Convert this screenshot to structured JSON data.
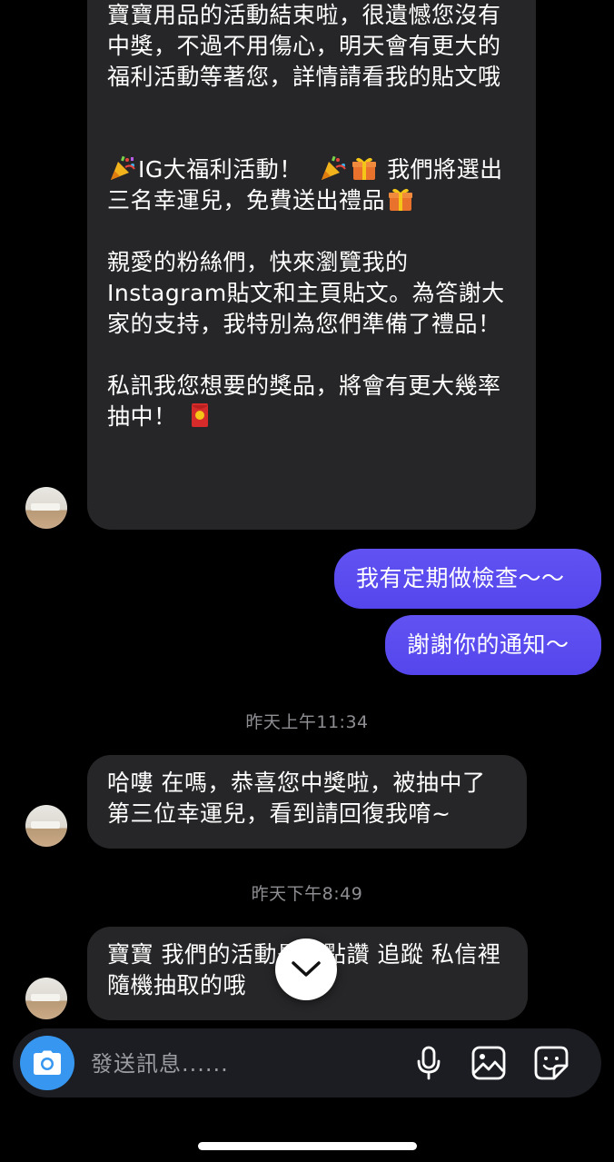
{
  "messages": {
    "first_incoming": {
      "p1": "寶寶用品的活動結束啦，很遺憾您沒有中獎，不過不用傷心，明天會有更大的福利活動等著您，詳情請看我的貼文哦",
      "p2_a": "IG大福利活動！",
      "p2_b": "我們將選出三名幸運兒，免費送出禮品",
      "p3": "親愛的粉絲們，快來瀏覽我的Instagram貼文和主頁貼文。為答謝大家的支持，我特別為您們準備了禮品！",
      "p4": "私訊我您想要的獎品，將會有更大幾率抽中！"
    },
    "outgoing_1": "我有定期做檢查～～",
    "outgoing_2": "謝謝你的通知～",
    "timestamp_1": "昨天上午11:34",
    "second_incoming": "哈嘍 在嗎，恭喜您中獎啦，被抽中了第三位幸運兒，看到請回復我唷~",
    "timestamp_2": "昨天下午8:49",
    "third_incoming": "寶寶 我們的活動是在點讚 追蹤 私信裡隨機抽取的哦"
  },
  "composer": {
    "placeholder": "發送訊息......"
  },
  "icons": {
    "party": "party-popper-icon",
    "gift": "gift-icon",
    "red_envelope": "red-envelope-icon",
    "camera": "camera-icon",
    "mic": "microphone-icon",
    "image": "image-icon",
    "sticker": "sticker-icon",
    "scroll": "chevron-down-icon"
  },
  "colors": {
    "incoming_bubble": "#262628",
    "outgoing_bubble": "#5b4ff0",
    "camera_button": "#3797f0",
    "timestamp": "#8e8e93"
  }
}
